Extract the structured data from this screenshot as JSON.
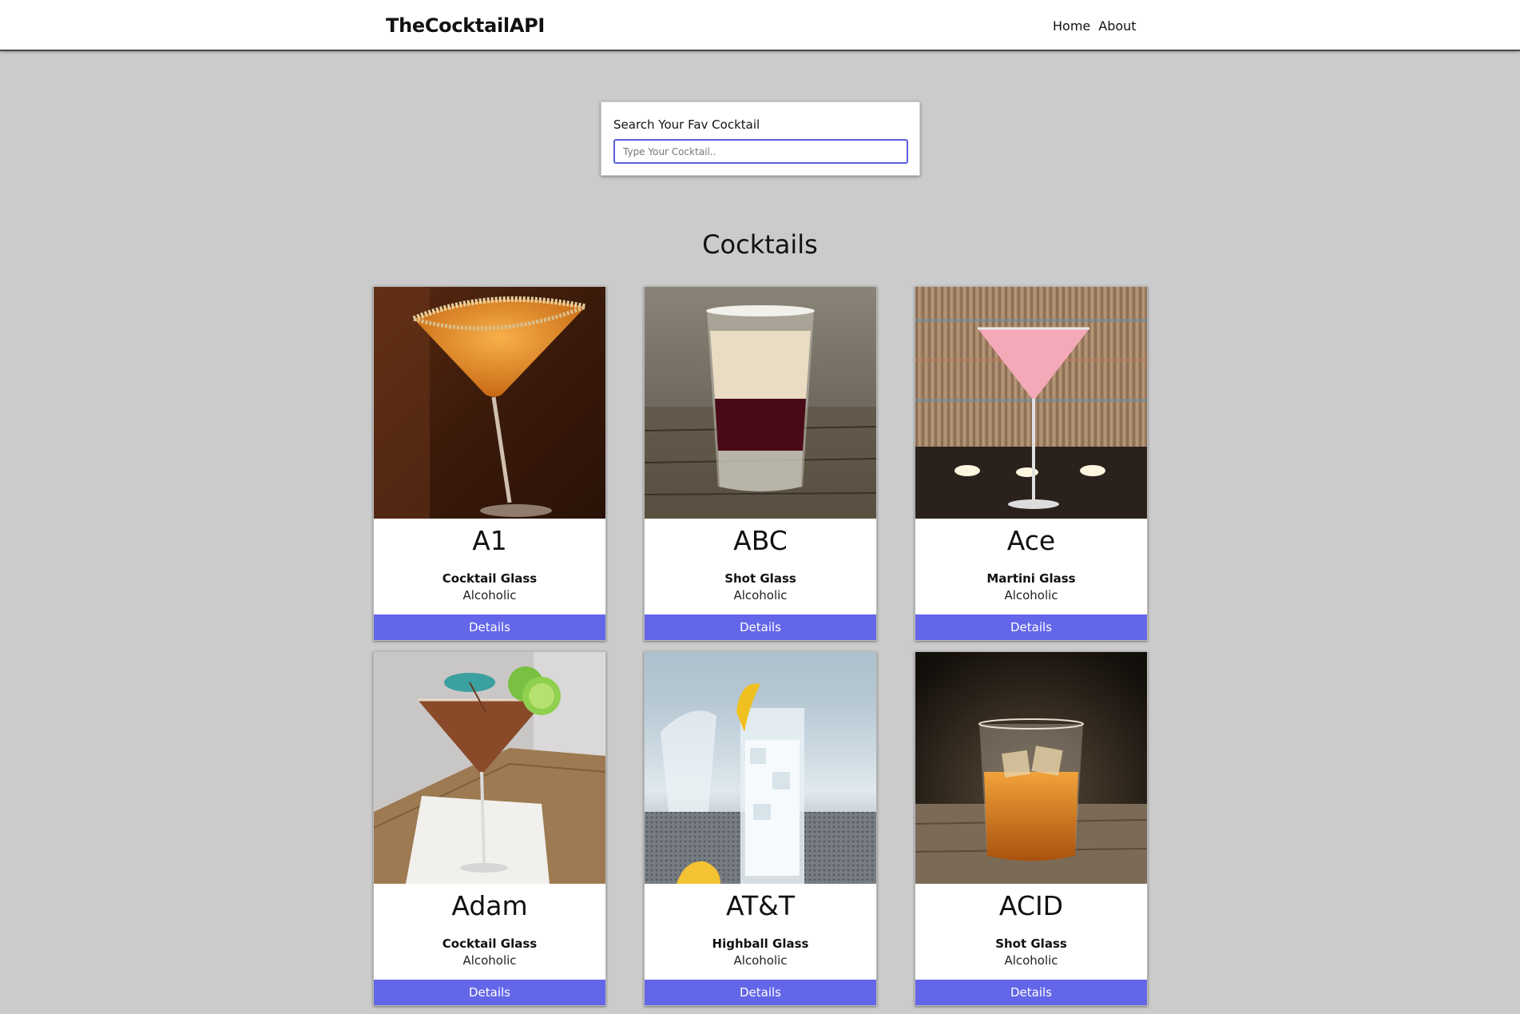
{
  "header": {
    "brand": "TheCocktailAPI",
    "nav": [
      {
        "label": "Home"
      },
      {
        "label": "About"
      }
    ]
  },
  "search": {
    "label": "Search Your Fav Cocktail",
    "placeholder": "Type Your Cocktail..",
    "value": ""
  },
  "section": {
    "title": "Cocktails"
  },
  "cocktails": [
    {
      "name": "A1",
      "glass": "Cocktail Glass",
      "type": "Alcoholic",
      "button": "Details",
      "image": "orange-martini-sugar-rim"
    },
    {
      "name": "ABC",
      "glass": "Shot Glass",
      "type": "Alcoholic",
      "button": "Details",
      "image": "layered-shot"
    },
    {
      "name": "Ace",
      "glass": "Martini Glass",
      "type": "Alcoholic",
      "button": "Details",
      "image": "pink-martini-candles"
    },
    {
      "name": "Adam",
      "glass": "Cocktail Glass",
      "type": "Alcoholic",
      "button": "Details",
      "image": "amber-martini-lime-umbrella"
    },
    {
      "name": "AT&T",
      "glass": "Highball Glass",
      "type": "Alcoholic",
      "button": "Details",
      "image": "clear-highball-lemon"
    },
    {
      "name": "ACID",
      "glass": "Shot Glass",
      "type": "Alcoholic",
      "button": "Details",
      "image": "whisky-rocks-glass"
    }
  ],
  "colors": {
    "background": "#cbcbcb",
    "accent": "#6366e8",
    "input_border": "#5a5fe0"
  }
}
